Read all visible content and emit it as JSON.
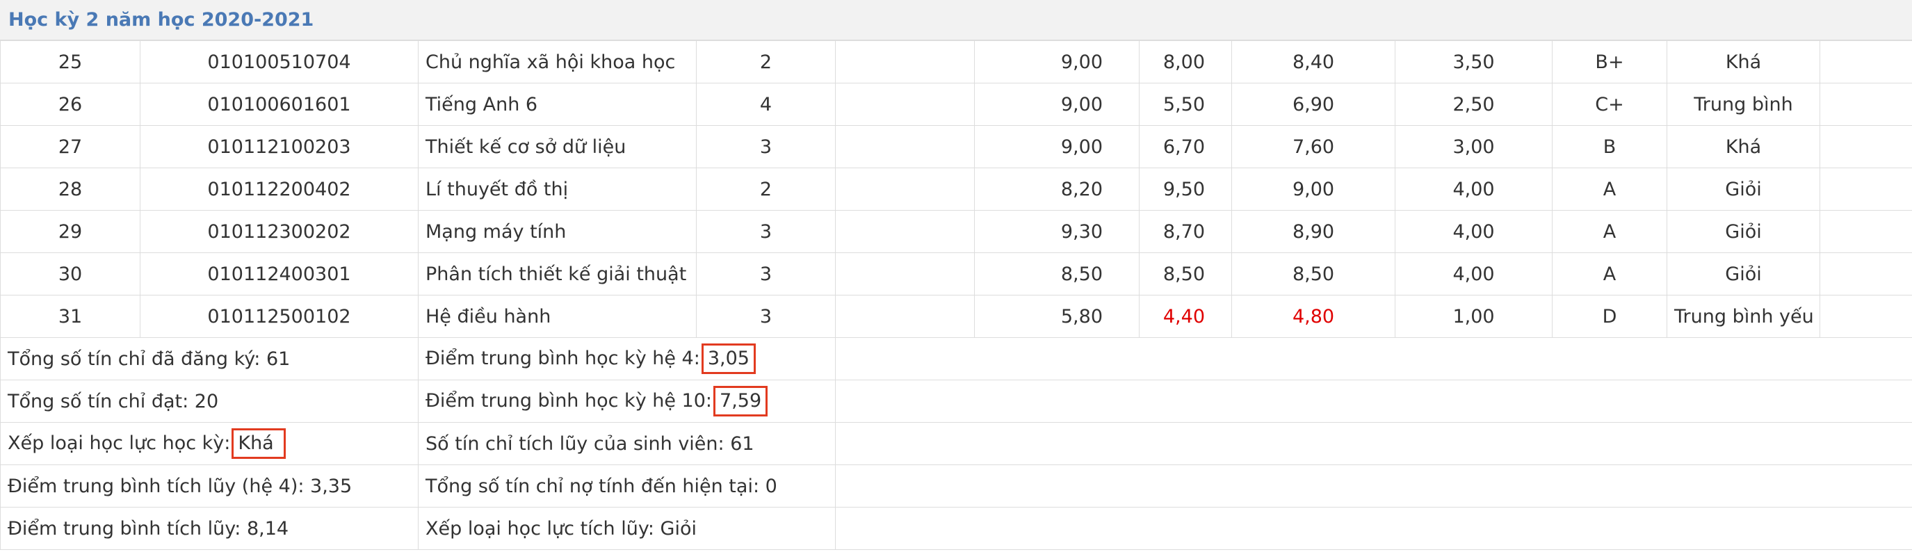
{
  "semester_title": "Học kỳ 2 năm học 2020-2021",
  "rows": [
    {
      "stt": "25",
      "code": "010100510704",
      "name": "Chủ nghĩa xã hội khoa học",
      "credits": "2",
      "blank": "",
      "s1": "9,00",
      "s2": "8,00",
      "s3": "8,40",
      "gpa4": "3,50",
      "letter": "B+",
      "rank": "Khá",
      "note": ""
    },
    {
      "stt": "26",
      "code": "010100601601",
      "name": "Tiếng Anh 6",
      "credits": "4",
      "blank": "",
      "s1": "9,00",
      "s2": "5,50",
      "s3": "6,90",
      "gpa4": "2,50",
      "letter": "C+",
      "rank": "Trung bình",
      "note": ""
    },
    {
      "stt": "27",
      "code": "010112100203",
      "name": "Thiết kế cơ sở dữ liệu",
      "credits": "3",
      "blank": "",
      "s1": "9,00",
      "s2": "6,70",
      "s3": "7,60",
      "gpa4": "3,00",
      "letter": "B",
      "rank": "Khá",
      "note": ""
    },
    {
      "stt": "28",
      "code": "010112200402",
      "name": "Lí thuyết đồ thị",
      "credits": "2",
      "blank": "",
      "s1": "8,20",
      "s2": "9,50",
      "s3": "9,00",
      "gpa4": "4,00",
      "letter": "A",
      "rank": "Giỏi",
      "note": ""
    },
    {
      "stt": "29",
      "code": "010112300202",
      "name": "Mạng máy tính",
      "credits": "3",
      "blank": "",
      "s1": "9,30",
      "s2": "8,70",
      "s3": "8,90",
      "gpa4": "4,00",
      "letter": "A",
      "rank": "Giỏi",
      "note": ""
    },
    {
      "stt": "30",
      "code": "010112400301",
      "name": "Phân tích thiết kế giải thuật",
      "credits": "3",
      "blank": "",
      "s1": "8,50",
      "s2": "8,50",
      "s3": "8,50",
      "gpa4": "4,00",
      "letter": "A",
      "rank": "Giỏi",
      "note": ""
    },
    {
      "stt": "31",
      "code": "010112500102",
      "name": "Hệ điều hành",
      "credits": "3",
      "blank": "",
      "s1": "5,80",
      "s2": "4,40",
      "s3": "4,80",
      "gpa4": "1,00",
      "letter": "D",
      "rank": "Trung bình yếu",
      "note": ""
    }
  ],
  "summary": {
    "registered_label": "Tổng số tín chỉ đã đăng ký: ",
    "registered_value": "61",
    "gpa4_label": "Điểm trung bình học kỳ hệ 4:",
    "gpa4_value": "3,05",
    "passed_label": "Tổng số tín chỉ đạt: ",
    "passed_value": "20",
    "gpa10_label": "Điểm trung bình học kỳ hệ 10:",
    "gpa10_value": "7,59",
    "rank_label": "Xếp loại học lực học kỳ:",
    "rank_value": "Khá",
    "accum_credits_label": "Số tín chỉ tích lũy của sinh viên: ",
    "accum_credits_value": "61",
    "accum_gpa4_label": "Điểm trung bình tích lũy (hệ 4): ",
    "accum_gpa4_value": "3,35",
    "debt_label": "Tổng số tín chỉ nợ tính đến hiện tại: ",
    "debt_value": "0",
    "accum_gpa10_label": "Điểm trung bình tích lũy: ",
    "accum_gpa10_value": "8,14",
    "accum_rank_label": "Xếp loại học lực tích lũy: ",
    "accum_rank_value": "Giỏi"
  },
  "colors": {
    "header_text": "#4a79b5",
    "failing_score": "#e00000",
    "highlight_box": "#e23b20"
  }
}
